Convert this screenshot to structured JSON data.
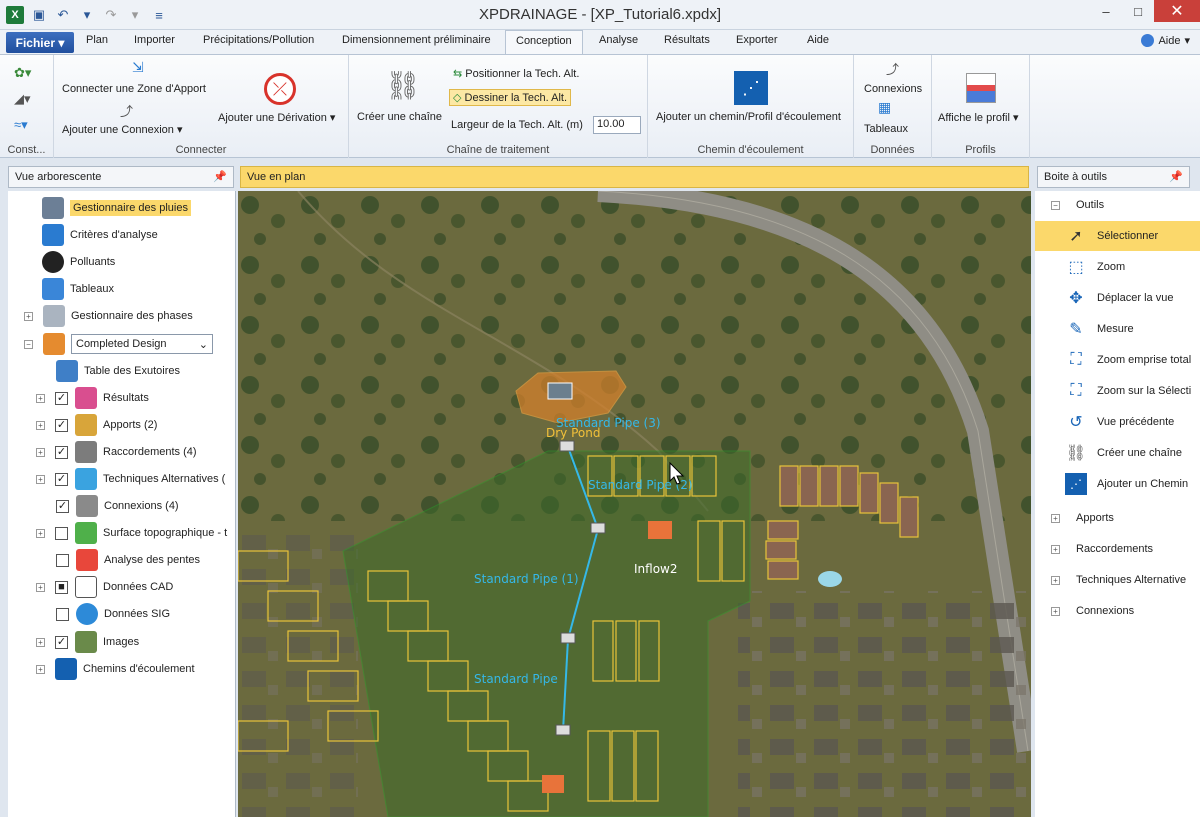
{
  "window": {
    "title": "XPDRAINAGE - [XP_Tutorial6.xpdx]",
    "controls": [
      "–",
      "□",
      "✕"
    ]
  },
  "ribbon_tabs": {
    "file": "Fichier",
    "tabs": [
      "Plan",
      "Importer",
      "Précipitations/Pollution",
      "Dimensionnement préliminaire",
      "Conception",
      "Analyse",
      "Résultats",
      "Exporter",
      "Aide"
    ],
    "active": "Conception",
    "help": "Aide"
  },
  "ribbon": {
    "const_label": "Const...",
    "connect": {
      "label": "Connecter",
      "add_zone": "Connecter une Zone d'Apport",
      "add_connection": "Ajouter une Connexion",
      "add_derivation": "Ajouter une Dérivation"
    },
    "chain": {
      "label": "Chaîne de traitement",
      "create_chain": "Créer une chaîne",
      "position": "Positionner la Tech. Alt.",
      "draw": "Dessiner la Tech. Alt.",
      "width_label": "Largeur de la Tech. Alt. (m)",
      "width_value": "10.00"
    },
    "flowpath": {
      "label": "Chemin d'écoulement",
      "add": "Ajouter un chemin/Profil d'écoulement"
    },
    "data": {
      "label": "Données",
      "connections": "Connexions",
      "tables": "Tableaux"
    },
    "profiles": {
      "label": "Profils",
      "show": "Affiche le profil"
    }
  },
  "tree": {
    "header": "Vue arborescente",
    "items": [
      {
        "label": "Gestionnaire des pluies",
        "selected": true
      },
      {
        "label": "Critères d'analyse"
      },
      {
        "label": "Polluants"
      },
      {
        "label": "Tableaux"
      },
      {
        "label": "Gestionnaire des phases"
      },
      {
        "label": "Completed Design"
      },
      {
        "label": "Table des Exutoires"
      },
      {
        "label": "Résultats"
      },
      {
        "label": "Apports (2)"
      },
      {
        "label": "Raccordements (4)"
      },
      {
        "label": "Techniques Alternatives ("
      },
      {
        "label": "Connexions (4)"
      },
      {
        "label": "Surface topographique - t"
      },
      {
        "label": "Analyse des pentes"
      },
      {
        "label": "Données CAD"
      },
      {
        "label": "Données SIG"
      },
      {
        "label": "Images"
      },
      {
        "label": "Chemins d'écoulement"
      }
    ]
  },
  "map": {
    "header": "Vue en plan",
    "labels": [
      "Standard Pipe (3)",
      "Dry Pond",
      "Standard Pipe (2)",
      "Standard Pipe (1)",
      "Inflow2",
      "Standard Pipe"
    ]
  },
  "toolbox": {
    "header": "Boite à outils",
    "section_tools": "Outils",
    "tools": [
      {
        "label": "Sélectionner",
        "icon": "cursor-icon",
        "selected": true
      },
      {
        "label": "Zoom",
        "icon": "zoom-icon"
      },
      {
        "label": "Déplacer la vue",
        "icon": "pan-icon"
      },
      {
        "label": "Mesure",
        "icon": "ruler-icon"
      },
      {
        "label": "Zoom emprise total",
        "icon": "zoom-extents-icon"
      },
      {
        "label": "Zoom sur la Sélecti",
        "icon": "zoom-selection-icon"
      },
      {
        "label": "Vue précédente",
        "icon": "previous-view-icon"
      },
      {
        "label": "Créer une chaîne",
        "icon": "chain-icon"
      },
      {
        "label": "Ajouter un Chemin",
        "icon": "flowpath-icon"
      }
    ],
    "sections": [
      "Apports",
      "Raccordements",
      "Techniques Alternative",
      "Connexions"
    ]
  },
  "colors": {
    "accent": "#fbd86b",
    "pipe": "#35b8e8",
    "lot_outline": "#e8c33a"
  }
}
